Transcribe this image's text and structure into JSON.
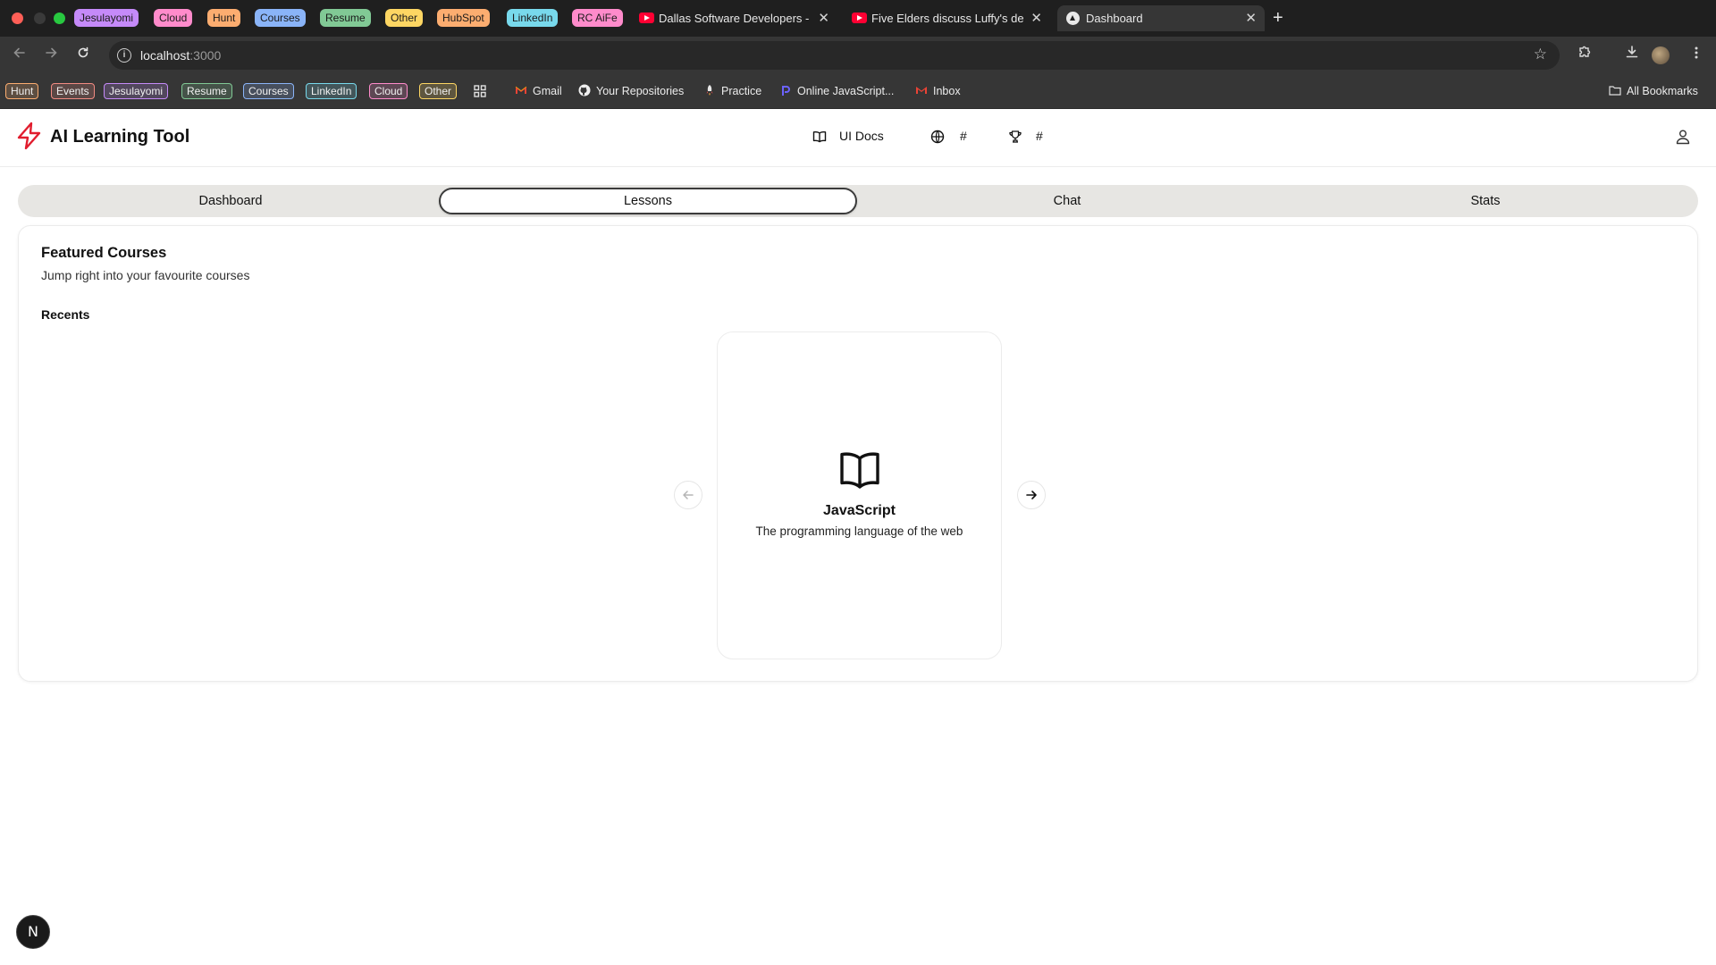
{
  "browser": {
    "tab_groups": [
      {
        "label": "Jesulayomi",
        "color": "#c58af9"
      },
      {
        "label": "Cloud",
        "color": "#ff8bcb"
      },
      {
        "label": "Hunt",
        "color": "#fcad70"
      },
      {
        "label": "Courses",
        "color": "#8ab4f8"
      },
      {
        "label": "Resume",
        "color": "#81c995"
      },
      {
        "label": "Other",
        "color": "#fdd663"
      },
      {
        "label": "HubSpot",
        "color": "#fcad70"
      },
      {
        "label": "LinkedIn",
        "color": "#78d9ec"
      },
      {
        "label": "RC AiFe",
        "color": "#ff8bcb"
      }
    ],
    "tabs": [
      {
        "title": "Dallas Software Developers - ",
        "favicon": "youtube-icon",
        "close": "✕"
      },
      {
        "title": "Five Elders discuss Luffy's de",
        "favicon": "youtube-icon",
        "close": "✕"
      },
      {
        "title": "Dashboard",
        "favicon": "vercel-icon",
        "close": "✕"
      }
    ],
    "new_tab": "+",
    "url": {
      "host": "localhost",
      "port": ":3000"
    },
    "bookmark_groups": [
      {
        "label": "Hunt",
        "color": "#fcad70"
      },
      {
        "label": "Events",
        "color": "#f28b82"
      },
      {
        "label": "Jesulayomi",
        "color": "#c58af9"
      },
      {
        "label": "Resume",
        "color": "#81c995"
      },
      {
        "label": "Courses",
        "color": "#8ab4f8"
      },
      {
        "label": "LinkedIn",
        "color": "#78d9ec"
      },
      {
        "label": "Cloud",
        "color": "#ff8bcb"
      },
      {
        "label": "Other",
        "color": "#fdd663"
      }
    ],
    "bookmarks": [
      {
        "label": "Gmail",
        "icon": "gmail-icon"
      },
      {
        "label": "Your Repositories",
        "icon": "github-icon"
      },
      {
        "label": "Practice",
        "icon": "rocket-icon"
      },
      {
        "label": "Online JavaScript...",
        "icon": "programiz-icon"
      },
      {
        "label": "Inbox",
        "icon": "gmail-icon"
      }
    ],
    "all_bookmarks": "All Bookmarks"
  },
  "app": {
    "brand": "AI Learning Tool",
    "header_links": [
      {
        "label": "UI Docs",
        "icon": "book-open-icon"
      },
      {
        "label": "#",
        "icon": "globe-icon"
      },
      {
        "label": "#",
        "icon": "trophy-icon"
      }
    ],
    "tabs": [
      {
        "label": "Dashboard",
        "active": false
      },
      {
        "label": "Lessons",
        "active": true
      },
      {
        "label": "Chat",
        "active": false
      },
      {
        "label": "Stats",
        "active": false
      }
    ],
    "featured": {
      "title": "Featured Courses",
      "description": "Jump right into your favourite courses",
      "recents_label": "Recents"
    },
    "course": {
      "title": "JavaScript",
      "description": "The programming language of the web",
      "icon": "book-open-icon"
    },
    "dev_badge": "N"
  }
}
